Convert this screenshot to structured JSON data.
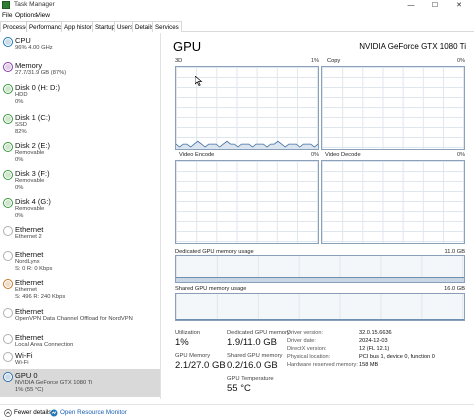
{
  "window": {
    "title": "Task Manager",
    "minimize": "—",
    "maximize": "☐",
    "close": "✕"
  },
  "menu": [
    "File",
    "Options",
    "View"
  ],
  "tabs": [
    "Processes",
    "Performance",
    "App history",
    "Startup",
    "Users",
    "Details",
    "Services"
  ],
  "active_tab": "Performance",
  "sidebar": [
    {
      "name": "CPU",
      "sub1": "96% 4.00 GHz",
      "sub2": "",
      "color": "#1f77b4"
    },
    {
      "name": "Memory",
      "sub1": "27.7/31.9 GB (87%)",
      "sub2": "",
      "color": "#8b3aa8"
    },
    {
      "name": "Disk 0 (H: D:)",
      "sub1": "HDD",
      "sub2": "0%",
      "color": "#3c9a3c"
    },
    {
      "name": "Disk 1 (C:)",
      "sub1": "SSD",
      "sub2": "82%",
      "color": "#3c9a3c"
    },
    {
      "name": "Disk 2 (E:)",
      "sub1": "Removable",
      "sub2": "0%",
      "color": "#3c9a3c"
    },
    {
      "name": "Disk 3 (F:)",
      "sub1": "Removable",
      "sub2": "0%",
      "color": "#3c9a3c"
    },
    {
      "name": "Disk 4 (G:)",
      "sub1": "Removable",
      "sub2": "0%",
      "color": "#3c9a3c"
    },
    {
      "name": "Ethernet",
      "sub1": "Ethernet 2",
      "sub2": "",
      "color": "#b0b0b0"
    },
    {
      "name": "Ethernet",
      "sub1": "NordLynx",
      "sub2": "S: 0 R: 0 Kbps",
      "color": "#b0b0b0"
    },
    {
      "name": "Ethernet",
      "sub1": "Ethernet",
      "sub2": "S: 496 R: 240 Kbps",
      "color": "#c8772a"
    },
    {
      "name": "Ethernet",
      "sub1": "OpenVPN Data Channel Offload for NordVPN",
      "sub2": "",
      "color": "#b0b0b0"
    },
    {
      "name": "Ethernet",
      "sub1": "Local Area Connection",
      "sub2": "",
      "color": "#b0b0b0"
    },
    {
      "name": "Wi-Fi",
      "sub1": "Wi-Fi",
      "sub2": "",
      "color": "#b0b0b0"
    },
    {
      "name": "GPU 0",
      "sub1": "NVIDIA GeForce GTX 1080 Ti",
      "sub2": "1% (55 °C)",
      "color": "#2f6fb0"
    }
  ],
  "gpu": {
    "title": "GPU",
    "model": "NVIDIA GeForce GTX 1080 Ti"
  },
  "graphs": [
    {
      "label": "3D",
      "pct": "1%"
    },
    {
      "label": "Copy",
      "pct": "0%"
    },
    {
      "label": "Video Encode",
      "pct": "0%"
    },
    {
      "label": "Video Decode",
      "pct": "0%"
    }
  ],
  "dedicated_mem": {
    "label": "Dedicated GPU memory usage",
    "max": "11.0 GB"
  },
  "shared_mem": {
    "label": "Shared GPU memory usage",
    "max": "16.0 GB"
  },
  "stats": {
    "utilization_label": "Utilization",
    "utilization": "1%",
    "dedicated_label": "Dedicated GPU memory",
    "dedicated": "1.9/11.0 GB",
    "gpu_memory_label": "GPU Memory",
    "gpu_memory": "2.1/27.0 GB",
    "shared_label": "Shared GPU memory",
    "shared": "0.2/16.0 GB",
    "temp_label": "GPU Temperature",
    "temp": "55 °C"
  },
  "driver": {
    "version_label": "Driver version:",
    "version": "32.0.15.6636",
    "date_label": "Driver date:",
    "date": "2024-12-03",
    "directx_label": "DirectX version:",
    "directx": "12 (FL 12.1)",
    "location_label": "Physical location:",
    "location": "PCI bus 1, device 0, function 0",
    "reserved_label": "Hardware reserved memory:",
    "reserved": "158 MB"
  },
  "footer": {
    "fewer": "Fewer details",
    "monitor": "Open Resource Monitor"
  },
  "chart_data": [
    {
      "type": "line",
      "title": "3D",
      "ylim": [
        0,
        100
      ],
      "series": [
        {
          "values": [
            1,
            0,
            1,
            1,
            0,
            1,
            2,
            1,
            0,
            1,
            1,
            1,
            0,
            1,
            2,
            1,
            1,
            0,
            1,
            1,
            1,
            0,
            1,
            1,
            1,
            0,
            1,
            1,
            2,
            1,
            0,
            1,
            1,
            1,
            0,
            1,
            1,
            1,
            0,
            1
          ]
        }
      ]
    }
  ]
}
